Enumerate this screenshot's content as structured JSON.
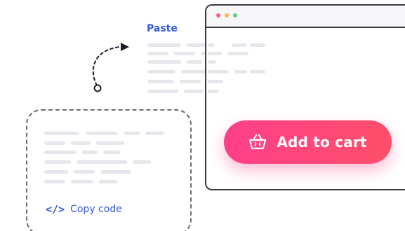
{
  "paste_label": "Paste",
  "copy_label": "Copy code",
  "code_icon": "</>",
  "cart_button_label": "Add to cart",
  "icons": {
    "cart": "shopping-basket-icon",
    "code": "code-brackets-icon"
  },
  "colors": {
    "accent_blue": "#3559d6",
    "cart_gradient_start": "#ff3f8a",
    "cart_gradient_end": "#ff4f6a",
    "window_dot_red": "#ff5c8a",
    "window_dot_yellow": "#ffb347",
    "window_dot_green": "#5cd18a"
  }
}
